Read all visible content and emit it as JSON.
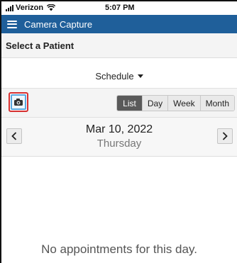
{
  "status_bar": {
    "carrier": "Verizon",
    "time": "5:07 PM",
    "signal_icon": "signal-bars-icon",
    "wifi_icon": "wifi-icon"
  },
  "header": {
    "menu_icon": "hamburger-menu-icon",
    "title": "Camera Capture",
    "background_color": "#1f5f9a"
  },
  "patient": {
    "select_label": "Select a Patient"
  },
  "schedule": {
    "dropdown_label": "Schedule"
  },
  "toolbar": {
    "camera_icon": "camera-icon",
    "views": [
      {
        "label": "List",
        "active": true
      },
      {
        "label": "Day",
        "active": false
      },
      {
        "label": "Week",
        "active": false
      },
      {
        "label": "Month",
        "active": false
      }
    ]
  },
  "date_nav": {
    "date": "Mar 10, 2022",
    "weekday": "Thursday",
    "prev_icon": "chevron-left-icon",
    "next_icon": "chevron-right-icon"
  },
  "appointments": {
    "empty_message": "No appointments for this day."
  }
}
